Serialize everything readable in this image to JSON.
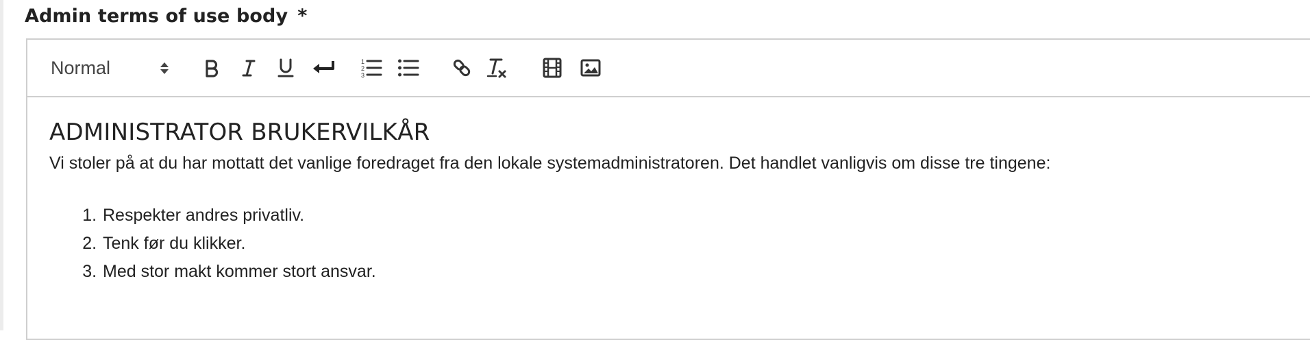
{
  "field": {
    "label": "Admin terms of use body",
    "required_mark": "*"
  },
  "toolbar": {
    "format_select_value": "Normal",
    "buttons": [
      {
        "name": "bold",
        "icon": "bold-icon"
      },
      {
        "name": "italic",
        "icon": "italic-icon"
      },
      {
        "name": "underline",
        "icon": "underline-icon"
      },
      {
        "name": "line-break",
        "icon": "return-icon"
      },
      {
        "name": "ordered-list",
        "icon": "ordered-list-icon"
      },
      {
        "name": "bullet-list",
        "icon": "bullet-list-icon"
      },
      {
        "name": "link",
        "icon": "link-icon"
      },
      {
        "name": "clear-formatting",
        "icon": "clear-format-icon"
      },
      {
        "name": "video",
        "icon": "film-icon"
      },
      {
        "name": "image",
        "icon": "image-icon"
      }
    ]
  },
  "document": {
    "heading": "ADMINISTRATOR BRUKERVILKÅR",
    "paragraph": "Vi stoler på at du har mottatt det vanlige foredraget fra den lokale systemadministratoren. Det handlet vanligvis om disse tre tingene:",
    "list": [
      "Respekter andres privatliv.",
      "Tenk før du klikker.",
      "Med stor makt kommer stort ansvar."
    ]
  },
  "colors": {
    "border": "#cfcfcf",
    "text": "#222222",
    "icon": "#333333"
  }
}
